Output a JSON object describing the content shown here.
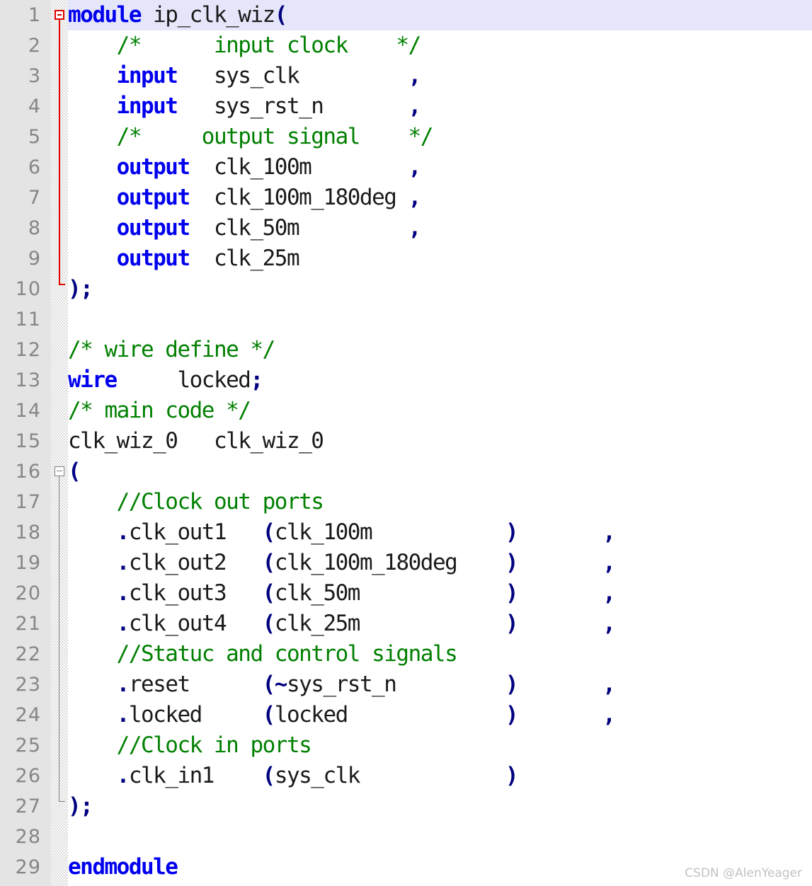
{
  "editor": {
    "language": "verilog",
    "total_lines": 29,
    "current_line": 1,
    "colors": {
      "keyword": "#0000ee",
      "comment": "#008000",
      "operator": "#000080",
      "identifier": "#1a1a1a",
      "gutter_background": "#e4e4e4",
      "gutter_text": "#868686",
      "current_line_highlight": "#e6e6fa",
      "fold_line_active": "#e00000",
      "fold_line_inactive": "#808080",
      "background": "#ffffff"
    }
  },
  "gutter": {
    "numbers": [
      "1",
      "2",
      "3",
      "4",
      "5",
      "6",
      "7",
      "8",
      "9",
      "10",
      "11",
      "12",
      "13",
      "14",
      "15",
      "16",
      "17",
      "18",
      "19",
      "20",
      "21",
      "22",
      "23",
      "24",
      "25",
      "26",
      "27",
      "28",
      "29"
    ]
  },
  "fold_markers": [
    {
      "line": 1,
      "style": "red",
      "type": "open"
    },
    {
      "line": 10,
      "style": "red",
      "type": "close"
    },
    {
      "line": 16,
      "style": "gray",
      "type": "open"
    },
    {
      "line": 27,
      "style": "gray",
      "type": "close"
    }
  ],
  "code_lines": [
    {
      "n": 1,
      "text": "module ip_clk_wiz("
    },
    {
      "n": 2,
      "text": "    /*      input clock    */"
    },
    {
      "n": 3,
      "text": "    input   sys_clk         ,"
    },
    {
      "n": 4,
      "text": "    input   sys_rst_n       ,"
    },
    {
      "n": 5,
      "text": "    /*     output signal    */"
    },
    {
      "n": 6,
      "text": "    output  clk_100m        ,"
    },
    {
      "n": 7,
      "text": "    output  clk_100m_180deg ,"
    },
    {
      "n": 8,
      "text": "    output  clk_50m         ,"
    },
    {
      "n": 9,
      "text": "    output  clk_25m"
    },
    {
      "n": 10,
      "text": ");"
    },
    {
      "n": 11,
      "text": ""
    },
    {
      "n": 12,
      "text": "/* wire define */"
    },
    {
      "n": 13,
      "text": "wire     locked;"
    },
    {
      "n": 14,
      "text": "/* main code */"
    },
    {
      "n": 15,
      "text": "clk_wiz_0   clk_wiz_0"
    },
    {
      "n": 16,
      "text": "("
    },
    {
      "n": 17,
      "text": "    //Clock out ports"
    },
    {
      "n": 18,
      "text": "    .clk_out1   (clk_100m           )       ,"
    },
    {
      "n": 19,
      "text": "    .clk_out2   (clk_100m_180deg    )       ,"
    },
    {
      "n": 20,
      "text": "    .clk_out3   (clk_50m            )       ,"
    },
    {
      "n": 21,
      "text": "    .clk_out4   (clk_25m            )       ,"
    },
    {
      "n": 22,
      "text": "    //Statuc and control signals"
    },
    {
      "n": 23,
      "text": "    .reset      (~sys_rst_n         )       ,"
    },
    {
      "n": 24,
      "text": "    .locked     (locked             )       ,"
    },
    {
      "n": 25,
      "text": "    //Clock in ports"
    },
    {
      "n": 26,
      "text": "    .clk_in1    (sys_clk            )"
    },
    {
      "n": 27,
      "text": ");"
    },
    {
      "n": 28,
      "text": ""
    },
    {
      "n": 29,
      "text": "endmodule"
    }
  ],
  "tokens": [
    {
      "n": 1,
      "parts": [
        {
          "t": "module",
          "c": "kw"
        },
        {
          "t": " ip_clk_wiz",
          "c": "id"
        },
        {
          "t": "(",
          "c": "op"
        }
      ]
    },
    {
      "n": 2,
      "parts": [
        {
          "t": "    ",
          "c": "id"
        },
        {
          "t": "/*      input clock    */",
          "c": "cmt"
        }
      ]
    },
    {
      "n": 3,
      "parts": [
        {
          "t": "    ",
          "c": "id"
        },
        {
          "t": "input",
          "c": "kw"
        },
        {
          "t": "   sys_clk         ",
          "c": "id"
        },
        {
          "t": ",",
          "c": "op"
        }
      ]
    },
    {
      "n": 4,
      "parts": [
        {
          "t": "    ",
          "c": "id"
        },
        {
          "t": "input",
          "c": "kw"
        },
        {
          "t": "   sys_rst_n       ",
          "c": "id"
        },
        {
          "t": ",",
          "c": "op"
        }
      ]
    },
    {
      "n": 5,
      "parts": [
        {
          "t": "    ",
          "c": "id"
        },
        {
          "t": "/*     output signal    */",
          "c": "cmt"
        }
      ]
    },
    {
      "n": 6,
      "parts": [
        {
          "t": "    ",
          "c": "id"
        },
        {
          "t": "output",
          "c": "kw"
        },
        {
          "t": "  clk_100m        ",
          "c": "id"
        },
        {
          "t": ",",
          "c": "op"
        }
      ]
    },
    {
      "n": 7,
      "parts": [
        {
          "t": "    ",
          "c": "id"
        },
        {
          "t": "output",
          "c": "kw"
        },
        {
          "t": "  clk_100m_180deg ",
          "c": "id"
        },
        {
          "t": ",",
          "c": "op"
        }
      ]
    },
    {
      "n": 8,
      "parts": [
        {
          "t": "    ",
          "c": "id"
        },
        {
          "t": "output",
          "c": "kw"
        },
        {
          "t": "  clk_50m         ",
          "c": "id"
        },
        {
          "t": ",",
          "c": "op"
        }
      ]
    },
    {
      "n": 9,
      "parts": [
        {
          "t": "    ",
          "c": "id"
        },
        {
          "t": "output",
          "c": "kw"
        },
        {
          "t": "  clk_25m",
          "c": "id"
        }
      ]
    },
    {
      "n": 10,
      "parts": [
        {
          "t": ");",
          "c": "op"
        }
      ]
    },
    {
      "n": 11,
      "parts": []
    },
    {
      "n": 12,
      "parts": [
        {
          "t": "/* wire define */",
          "c": "cmt"
        }
      ]
    },
    {
      "n": 13,
      "parts": [
        {
          "t": "wire",
          "c": "kw"
        },
        {
          "t": "     locked",
          "c": "id"
        },
        {
          "t": ";",
          "c": "op"
        }
      ]
    },
    {
      "n": 14,
      "parts": [
        {
          "t": "/* main code */",
          "c": "cmt"
        }
      ]
    },
    {
      "n": 15,
      "parts": [
        {
          "t": "clk_wiz_0   clk_wiz_0",
          "c": "id"
        }
      ]
    },
    {
      "n": 16,
      "parts": [
        {
          "t": "(",
          "c": "op"
        }
      ]
    },
    {
      "n": 17,
      "parts": [
        {
          "t": "    ",
          "c": "id"
        },
        {
          "t": "//Clock out ports",
          "c": "cmt"
        }
      ]
    },
    {
      "n": 18,
      "parts": [
        {
          "t": "    ",
          "c": "id"
        },
        {
          "t": ".",
          "c": "op"
        },
        {
          "t": "clk_out1   ",
          "c": "id"
        },
        {
          "t": "(",
          "c": "op"
        },
        {
          "t": "clk_100m           ",
          "c": "id"
        },
        {
          "t": ")",
          "c": "op"
        },
        {
          "t": "       ",
          "c": "id"
        },
        {
          "t": ",",
          "c": "op"
        }
      ]
    },
    {
      "n": 19,
      "parts": [
        {
          "t": "    ",
          "c": "id"
        },
        {
          "t": ".",
          "c": "op"
        },
        {
          "t": "clk_out2   ",
          "c": "id"
        },
        {
          "t": "(",
          "c": "op"
        },
        {
          "t": "clk_100m_180deg    ",
          "c": "id"
        },
        {
          "t": ")",
          "c": "op"
        },
        {
          "t": "       ",
          "c": "id"
        },
        {
          "t": ",",
          "c": "op"
        }
      ]
    },
    {
      "n": 20,
      "parts": [
        {
          "t": "    ",
          "c": "id"
        },
        {
          "t": ".",
          "c": "op"
        },
        {
          "t": "clk_out3   ",
          "c": "id"
        },
        {
          "t": "(",
          "c": "op"
        },
        {
          "t": "clk_50m            ",
          "c": "id"
        },
        {
          "t": ")",
          "c": "op"
        },
        {
          "t": "       ",
          "c": "id"
        },
        {
          "t": ",",
          "c": "op"
        }
      ]
    },
    {
      "n": 21,
      "parts": [
        {
          "t": "    ",
          "c": "id"
        },
        {
          "t": ".",
          "c": "op"
        },
        {
          "t": "clk_out4   ",
          "c": "id"
        },
        {
          "t": "(",
          "c": "op"
        },
        {
          "t": "clk_25m            ",
          "c": "id"
        },
        {
          "t": ")",
          "c": "op"
        },
        {
          "t": "       ",
          "c": "id"
        },
        {
          "t": ",",
          "c": "op"
        }
      ]
    },
    {
      "n": 22,
      "parts": [
        {
          "t": "    ",
          "c": "id"
        },
        {
          "t": "//Statuc and control signals",
          "c": "cmt"
        }
      ]
    },
    {
      "n": 23,
      "parts": [
        {
          "t": "    ",
          "c": "id"
        },
        {
          "t": ".",
          "c": "op"
        },
        {
          "t": "reset      ",
          "c": "id"
        },
        {
          "t": "(~",
          "c": "op"
        },
        {
          "t": "sys_rst_n         ",
          "c": "id"
        },
        {
          "t": ")",
          "c": "op"
        },
        {
          "t": "       ",
          "c": "id"
        },
        {
          "t": ",",
          "c": "op"
        }
      ]
    },
    {
      "n": 24,
      "parts": [
        {
          "t": "    ",
          "c": "id"
        },
        {
          "t": ".",
          "c": "op"
        },
        {
          "t": "locked     ",
          "c": "id"
        },
        {
          "t": "(",
          "c": "op"
        },
        {
          "t": "locked             ",
          "c": "id"
        },
        {
          "t": ")",
          "c": "op"
        },
        {
          "t": "       ",
          "c": "id"
        },
        {
          "t": ",",
          "c": "op"
        }
      ]
    },
    {
      "n": 25,
      "parts": [
        {
          "t": "    ",
          "c": "id"
        },
        {
          "t": "//Clock in ports",
          "c": "cmt"
        }
      ]
    },
    {
      "n": 26,
      "parts": [
        {
          "t": "    ",
          "c": "id"
        },
        {
          "t": ".",
          "c": "op"
        },
        {
          "t": "clk_in1    ",
          "c": "id"
        },
        {
          "t": "(",
          "c": "op"
        },
        {
          "t": "sys_clk            ",
          "c": "id"
        },
        {
          "t": ")",
          "c": "op"
        }
      ]
    },
    {
      "n": 27,
      "parts": [
        {
          "t": ");",
          "c": "op"
        }
      ]
    },
    {
      "n": 28,
      "parts": []
    },
    {
      "n": 29,
      "parts": [
        {
          "t": "endmodule",
          "c": "kw"
        }
      ]
    }
  ],
  "watermark": {
    "text": "CSDN @AlenYeager"
  }
}
